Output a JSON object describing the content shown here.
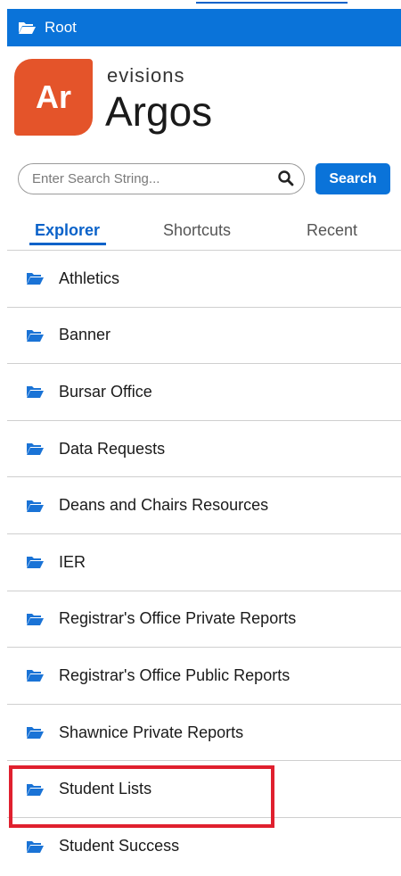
{
  "header": {
    "root_label": "Root"
  },
  "logo": {
    "badge_text": "Ar",
    "brand": "evisions",
    "product": "Argos"
  },
  "search": {
    "placeholder": "Enter Search String...",
    "button_label": "Search"
  },
  "tabs": [
    {
      "label": "Explorer",
      "active": true
    },
    {
      "label": "Shortcuts",
      "active": false
    },
    {
      "label": "Recent",
      "active": false
    }
  ],
  "folders": [
    {
      "label": "Athletics"
    },
    {
      "label": "Banner"
    },
    {
      "label": "Bursar Office"
    },
    {
      "label": "Data Requests"
    },
    {
      "label": "Deans and Chairs Resources"
    },
    {
      "label": "IER"
    },
    {
      "label": "Registrar's Office Private Reports"
    },
    {
      "label": "Registrar's Office Public Reports"
    },
    {
      "label": "Shawnice Private Reports"
    },
    {
      "label": "Student Lists",
      "highlighted": true
    },
    {
      "label": "Student Success"
    }
  ],
  "colors": {
    "accent_blue": "#0a73d9",
    "logo_orange": "#e4542a",
    "highlight_red": "#e0202e"
  },
  "icons": {
    "folder": "folder-open-icon",
    "search": "search-icon"
  }
}
